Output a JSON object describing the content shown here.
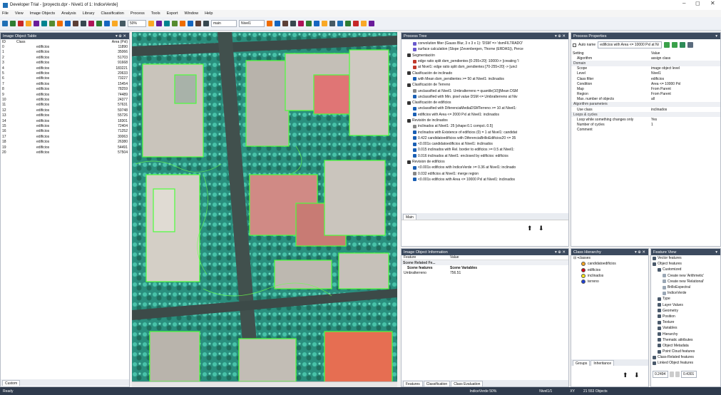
{
  "window": {
    "title": "Developer Trial - [proyecto.dpr - Nivel1 of 1: IndiceVerde]",
    "min_glyph": "–",
    "max_glyph": "◻",
    "close_glyph": "✕"
  },
  "menu": [
    "File",
    "View",
    "Image Objects",
    "Analysis",
    "Library",
    "Classification",
    "Process",
    "Tools",
    "Export",
    "Window",
    "Help"
  ],
  "toolbar": {
    "zoom": "50%",
    "layer_select": "main",
    "level_select": "Nivel1"
  },
  "colors": {
    "panel_header": "#3c4a5e",
    "accent": "#1f6fb5"
  },
  "image_object_table": {
    "title": "Image Object Table",
    "columns": [
      "ID",
      "Class",
      "Area (Pxl)"
    ],
    "rows": [
      [
        "0",
        "edificios",
        "11890"
      ],
      [
        "1",
        "edificios",
        "35066"
      ],
      [
        "2",
        "edificios",
        "51703"
      ],
      [
        "3",
        "edificios",
        "91668"
      ],
      [
        "4",
        "edificios",
        "183221"
      ],
      [
        "5",
        "edificios",
        "20633"
      ],
      [
        "6",
        "edificios",
        "73227"
      ],
      [
        "7",
        "edificios",
        "15454"
      ],
      [
        "8",
        "edificios",
        "78259"
      ],
      [
        "9",
        "edificios",
        "74489"
      ],
      [
        "10",
        "edificios",
        "24377"
      ],
      [
        "11",
        "edificios",
        "57631"
      ],
      [
        "12",
        "edificios",
        "59748"
      ],
      [
        "13",
        "edificios",
        "55726"
      ],
      [
        "14",
        "edificios",
        "18301"
      ],
      [
        "15",
        "edificios",
        "72404"
      ],
      [
        "16",
        "edificios",
        "71252"
      ],
      [
        "17",
        "edificios",
        "30063"
      ],
      [
        "18",
        "edificios",
        "26380"
      ],
      [
        "19",
        "edificios",
        "54491"
      ],
      [
        "20",
        "edificios",
        "57504"
      ]
    ],
    "tab": "Custom"
  },
  "process_tree": {
    "title": "Process Tree",
    "tab": "Main",
    "items": [
      {
        "text": "convolution filter (Gauss Blur, 3 x 3 x 1): 'DSM' => 'dsmFILTRADO'",
        "indent": 2,
        "icon": "#6a5acd"
      },
      {
        "text": "surface calculation (Slope (Zevenbergen, Thorne (ERDAS)), Perce",
        "indent": 2,
        "icon": "#6a5acd"
      },
      {
        "text": "Segmentación",
        "indent": 1,
        "icon": "#333"
      },
      {
        "text": "edge ratio split dsm_pendientes [0-255+20] :10000-> [creating 'I",
        "indent": 2,
        "icon": "#c0392b"
      },
      {
        "text": "at  Nivel1: edge ratio split dsm_pendientes [70-255+20] -> [uncl",
        "indent": 2,
        "icon": "#c0392b"
      },
      {
        "text": "Clasificación de inclinado",
        "indent": 1,
        "icon": "#333"
      },
      {
        "text": "with Mean dsm_pendientes >= 50  at  Nivel1: inclinados",
        "indent": 2,
        "icon": "#1a5fb4"
      },
      {
        "text": "Clasificación de Terreno",
        "indent": 1,
        "icon": "#333"
      },
      {
        "text": "unclassified at  Nivel1: Umbralterreno = quantile(10)[Mean DSM",
        "indent": 2,
        "icon": "#888"
      },
      {
        "text": "unclassified with Min. pixel value DSM <= Umbralterreno  at  Niv",
        "indent": 2,
        "icon": "#1a5fb4"
      },
      {
        "text": "Clasificación de edificios",
        "indent": 1,
        "icon": "#333"
      },
      {
        "text": "unclassified with DiferenciaMediaDSMTerreno >= 10  at  Nivel1:",
        "indent": 2,
        "icon": "#1a5fb4"
      },
      {
        "text": "edificios with Area <= 2000 Pxl  at  Nivel1: inclinados",
        "indent": 2,
        "icon": "#1a5fb4"
      },
      {
        "text": "Revisión de inclinados",
        "indent": 1,
        "icon": "#333"
      },
      {
        "text": "inclinados at  Nivel1: 25 [shape:0.1 compct.:0.5]",
        "indent": 2,
        "icon": "#888"
      },
      {
        "text": "inclinados with Existence of edificios (0) = 1  at  Nivel1: candidat",
        "indent": 2,
        "icon": "#1a5fb4"
      },
      {
        "text": "0.422  candidatoedificios with DiferenciaBrilloEdificios20 <= 35",
        "indent": 2,
        "icon": "#1a5fb4"
      },
      {
        "text": "<0.001s  candidatoedificios at  Nivel1: inclinados",
        "indent": 2,
        "icon": "#1a5fb4"
      },
      {
        "text": "0.015  inclinados with Rel. border to edificios >= 0.5  at  Nivel1:",
        "indent": 2,
        "icon": "#1a5fb4"
      },
      {
        "text": "0.016  inclinados at  Nivel1: enclosed by edificios: edificios",
        "indent": 2,
        "icon": "#1a5fb4"
      },
      {
        "text": "Revision de edificios",
        "indent": 1,
        "icon": "#333"
      },
      {
        "text": "<0.001s  edificios with IndiceVerde >= 0.36  at  Nivel1: inclinado",
        "indent": 2,
        "icon": "#1a5fb4"
      },
      {
        "text": "0.032  edificios at  Nivel1: merge region",
        "indent": 2,
        "icon": "#888"
      },
      {
        "text": "<0.001s  edificios with Area <= 10000 Pxl  at  Nivel1: inclinados",
        "indent": 2,
        "icon": "#1a5fb4"
      }
    ]
  },
  "process_properties": {
    "title": "Process Properties",
    "autoname_label": "Auto name",
    "autoname_value": "edificios with Area <= 10000 Pxl at Ni",
    "header": [
      "Setting",
      "Value"
    ],
    "rows": [
      {
        "k": "Algorithm",
        "v": "assign class",
        "sec": false
      },
      {
        "k": "Domain",
        "v": "",
        "sec": true
      },
      {
        "k": "Scope",
        "v": "image object level",
        "sec": false
      },
      {
        "k": "Level",
        "v": "Nivel1",
        "sec": false
      },
      {
        "k": "Class filter",
        "v": "edificios",
        "sec": false
      },
      {
        "k": "Condition",
        "v": "Area <= 10000 Pxl",
        "sec": false
      },
      {
        "k": "Map",
        "v": "From Parent",
        "sec": false
      },
      {
        "k": "Region",
        "v": "From Parent",
        "sec": false
      },
      {
        "k": "Max. number of objects",
        "v": "all",
        "sec": false
      },
      {
        "k": "Algorithm parameters",
        "v": "",
        "sec": true
      },
      {
        "k": "Use class",
        "v": "inclinados",
        "sec": false
      },
      {
        "k": "Loops & cycles",
        "v": "",
        "sec": true
      },
      {
        "k": "Loop while something changes only",
        "v": "Yes",
        "sec": false
      },
      {
        "k": "Number of cycles",
        "v": "1",
        "sec": false
      },
      {
        "k": "Comment",
        "v": "",
        "sec": false
      }
    ]
  },
  "image_object_info": {
    "title": "Image Object Information",
    "columns": [
      "Feature",
      "Value"
    ],
    "group": "Scene Related Fe...",
    "subheader": [
      "Scene features",
      "Scene Variables"
    ],
    "rows": [
      [
        "Umbralterreno",
        "756.51"
      ]
    ],
    "tabs": [
      "Features",
      "Classification",
      "Class Evaluation"
    ]
  },
  "class_hierarchy": {
    "title": "Class Hierarchy",
    "root": "classes",
    "classes": [
      {
        "name": "candidatoedificios",
        "color": "#f5a623"
      },
      {
        "name": "edificios",
        "color": "#d0021b"
      },
      {
        "name": "inclinados",
        "color": "#f8e71c"
      },
      {
        "name": "terreno",
        "color": "#1d3fd6"
      }
    ],
    "tabs": [
      "Groups",
      "Inheritance"
    ]
  },
  "feature_view": {
    "title": "Feature View",
    "items": [
      {
        "t": "Vector features",
        "i": 1
      },
      {
        "t": "Object features",
        "i": 1
      },
      {
        "t": "Customized",
        "i": 2
      },
      {
        "t": "Create new 'Arithmetic'",
        "i": 3
      },
      {
        "t": "Create new 'Relational'",
        "i": 3
      },
      {
        "t": "BrilloEspectral",
        "i": 3
      },
      {
        "t": "IndiceVerde",
        "i": 3
      },
      {
        "t": "Type",
        "i": 2
      },
      {
        "t": "Layer Values",
        "i": 2
      },
      {
        "t": "Geometry",
        "i": 2
      },
      {
        "t": "Position",
        "i": 2
      },
      {
        "t": "Texture",
        "i": 2
      },
      {
        "t": "Variables",
        "i": 2
      },
      {
        "t": "Hierarchy",
        "i": 2
      },
      {
        "t": "Thematic attributes",
        "i": 2
      },
      {
        "t": "Object Metadata",
        "i": 2
      },
      {
        "t": "Point Cloud features",
        "i": 2
      },
      {
        "t": "Class-Related features",
        "i": 1
      },
      {
        "t": "Linked Object features",
        "i": 1
      }
    ],
    "range_min": "0.2494",
    "range_max": "0.4301"
  },
  "statusbar": {
    "ready": "Ready",
    "layer": "IndiceVerde  50%",
    "level": "Nivel1/1",
    "xy": "XY",
    "objects": "21 553 Objects"
  }
}
